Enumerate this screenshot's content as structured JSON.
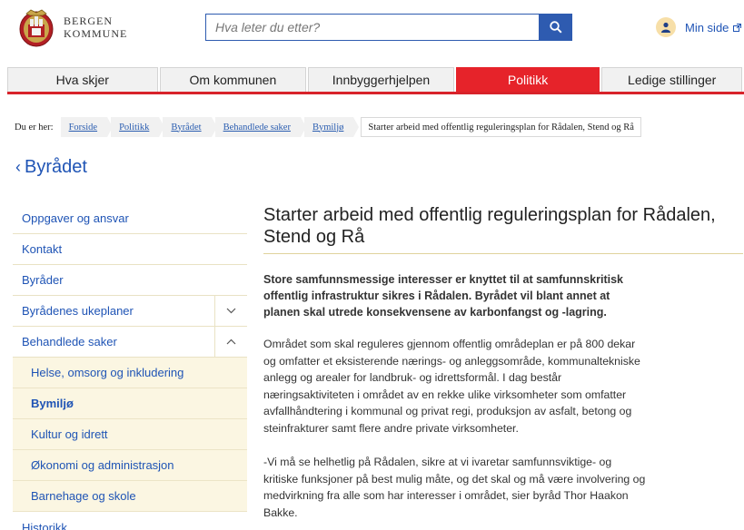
{
  "header": {
    "brand_line1": "BERGEN",
    "brand_line2": "KOMMUNE",
    "search_placeholder": "Hva leter du etter?",
    "my_page": "Min side"
  },
  "nav": {
    "tabs": [
      {
        "label": "Hva skjer",
        "active": false
      },
      {
        "label": "Om kommunen",
        "active": false
      },
      {
        "label": "Innbyggerhjelpen",
        "active": false
      },
      {
        "label": "Politikk",
        "active": true
      },
      {
        "label": "Ledige stillinger",
        "active": false
      }
    ]
  },
  "breadcrumb": {
    "prefix": "Du er her:",
    "items": [
      "Forside",
      "Politikk",
      "Byrådet",
      "Behandlede saker",
      "Bymiljø"
    ],
    "current": "Starter arbeid med offentlig reguleringsplan for Rådalen, Stend og Rå"
  },
  "section_back": "Byrådet",
  "sidebar": {
    "items": [
      {
        "label": "Oppgaver og ansvar"
      },
      {
        "label": "Kontakt"
      },
      {
        "label": "Byråder"
      },
      {
        "label": "Byrådenes ukeplaner",
        "toggle": "expand"
      },
      {
        "label": "Behandlede saker",
        "toggle": "collapse"
      }
    ],
    "subitems": [
      {
        "label": "Helse, omsorg og inkludering",
        "current": false
      },
      {
        "label": "Bymiljø",
        "current": true
      },
      {
        "label": "Kultur og idrett",
        "current": false
      },
      {
        "label": "Økonomi og administrasjon",
        "current": false
      },
      {
        "label": "Barnehage og skole",
        "current": false
      }
    ],
    "after": [
      {
        "label": "Historikk"
      }
    ]
  },
  "article": {
    "title": "Starter arbeid med offentlig reguleringsplan for Rådalen, Stend og Rå",
    "lead": "Store samfunnsmessige interesser er knyttet til at samfunnskritisk offentlig infrastruktur sikres i Rådalen. Byrådet vil blant annet at planen skal utrede konsekvensene av karbonfangst og -lagring.",
    "paragraphs": [
      "Området som skal reguleres gjennom offentlig områdeplan er på 800 dekar og omfatter et eksisterende nærings- og anleggsområde, kommunaltekniske anlegg og arealer for landbruk- og idrettsformål. I dag består næringsaktiviteten i området av en rekke ulike virksomheter som omfatter avfallhåndtering i kommunal og privat regi, produksjon av asfalt, betong og steinfrakturer samt flere andre private virksomheter.",
      "-Vi må se helhetlig på Rådalen, sikre at vi ivaretar samfunnsviktige- og kritiske funksjoner på best mulig måte, og det skal og må være involvering og medvirkning fra alle som har interesser i området, sier byråd Thor Haakon Bakke."
    ]
  },
  "colors": {
    "accent_red": "#e6232a",
    "link_blue": "#1f54b5",
    "search_blue": "#2e5bb0",
    "sub_bg": "#fbf6e2"
  }
}
